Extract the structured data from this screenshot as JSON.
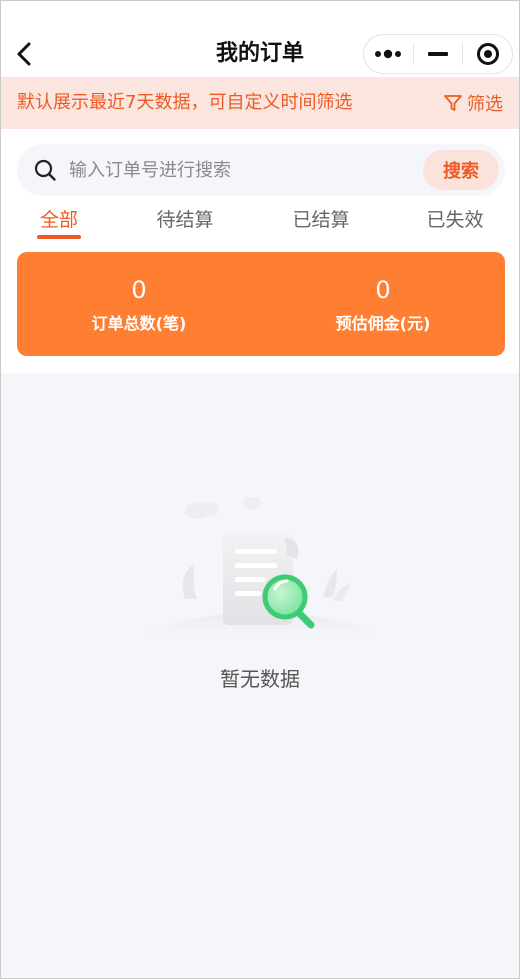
{
  "header": {
    "title": "我的订单"
  },
  "notice": {
    "text": "默认展示最近7天数据，可自定义时间筛选",
    "filter_label": "筛选"
  },
  "search": {
    "placeholder": "输入订单号进行搜索",
    "value": "",
    "button_label": "搜索"
  },
  "tabs": [
    {
      "label": "全部",
      "active": true
    },
    {
      "label": "待结算",
      "active": false
    },
    {
      "label": "已结算",
      "active": false
    },
    {
      "label": "已失效",
      "active": false
    }
  ],
  "stats": [
    {
      "value": "0",
      "label": "订单总数(笔)"
    },
    {
      "value": "0",
      "label": "预估佣金(元)"
    }
  ],
  "empty": {
    "text": "暂无数据"
  },
  "colors": {
    "accent": "#ee5a24",
    "stats_bg": "#ff7f32",
    "notice_bg": "#fbe6df",
    "page_bg": "#f5f6fa"
  },
  "icons": {
    "back": "chevron-left-icon",
    "more": "more-dots-icon",
    "minimize": "minimize-icon",
    "close": "target-circle-icon",
    "filter": "funnel-icon",
    "search": "search-icon",
    "empty": "empty-document-magnifier-icon"
  }
}
